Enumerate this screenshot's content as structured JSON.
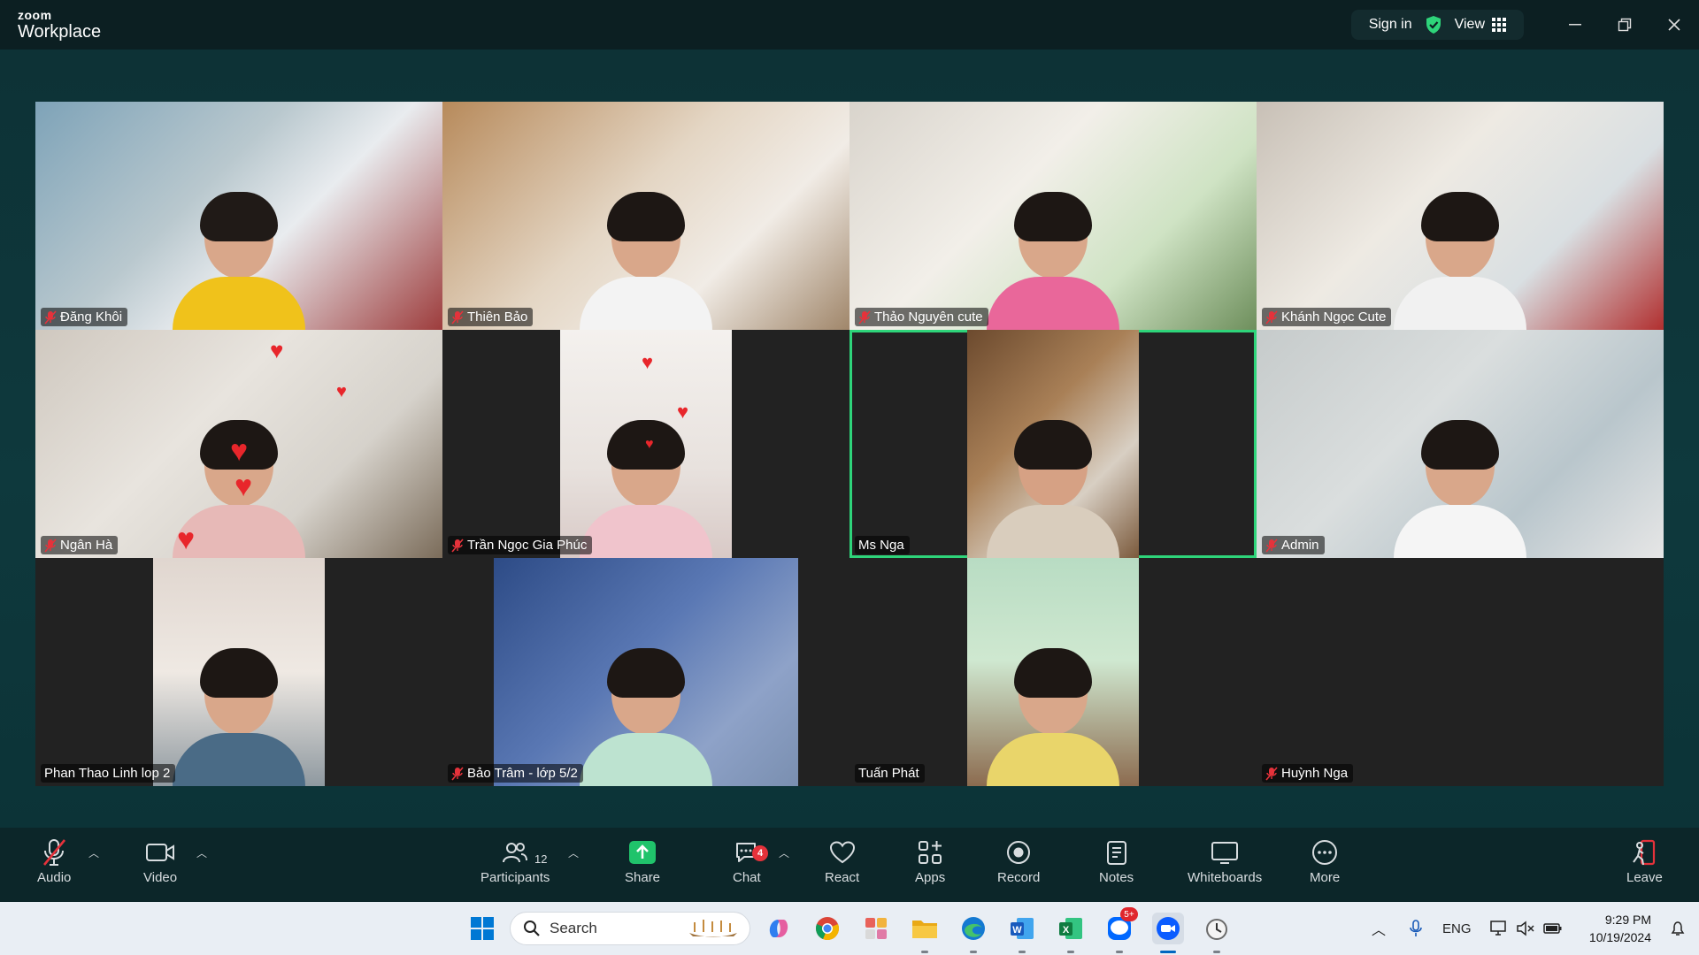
{
  "app": {
    "logo_top": "zoom",
    "logo_bottom": "Workplace",
    "sign_in": "Sign in",
    "view": "View"
  },
  "participants": [
    {
      "name": "Đăng Khôi",
      "muted": true
    },
    {
      "name": "Thiên Bảo",
      "muted": true
    },
    {
      "name": "Thảo Nguyên cute",
      "muted": true
    },
    {
      "name": "Khánh Ngọc Cute",
      "muted": true
    },
    {
      "name": "Ngân Hà",
      "muted": true
    },
    {
      "name": "Trần Ngọc Gia Phúc",
      "muted": true
    },
    {
      "name": "Ms Nga",
      "muted": false,
      "active_speaker": true
    },
    {
      "name": "Admin",
      "muted": true
    },
    {
      "name": "Phan Thao Linh lop 2",
      "muted": false
    },
    {
      "name": "Bảo Trâm - lớp 5/2",
      "muted": true
    },
    {
      "name": "Tuấn Phát",
      "muted": false
    },
    {
      "name": "Huỳnh Nga",
      "muted": true
    }
  ],
  "toolbar": {
    "audio": "Audio",
    "video": "Video",
    "participants": "Participants",
    "participants_count": "12",
    "share": "Share",
    "chat": "Chat",
    "chat_badge": "4",
    "react": "React",
    "apps": "Apps",
    "record": "Record",
    "notes": "Notes",
    "whiteboards": "Whiteboards",
    "more": "More",
    "leave": "Leave"
  },
  "taskbar": {
    "search_placeholder": "Search",
    "zalo_badge": "5+",
    "language": "ENG",
    "time": "9:29 PM",
    "date": "10/19/2024"
  },
  "colors": {
    "active_speaker_border": "#2ed47a",
    "share_green": "#20c36b",
    "badge_red": "#e5323b",
    "leave_red": "#e5323b"
  }
}
